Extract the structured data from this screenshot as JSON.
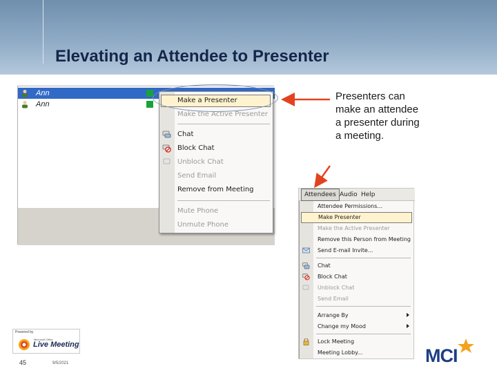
{
  "slide": {
    "title": "Elevating an Attendee to Presenter",
    "page_number": "45",
    "date": "9/5/2021"
  },
  "left_screenshot": {
    "attendees": [
      {
        "name": "Ann",
        "selected": true,
        "status_color": "#17a33a"
      },
      {
        "name": "Ann",
        "selected": false,
        "status_color": "#17a33a"
      }
    ],
    "context_menu": {
      "items": [
        {
          "label": "Make a Presenter",
          "highlighted": true,
          "disabled": false,
          "icon": ""
        },
        {
          "label": "Make the Active Presenter",
          "highlighted": false,
          "disabled": true,
          "icon": ""
        },
        {
          "label": "Chat",
          "highlighted": false,
          "disabled": false,
          "icon": "chat-icon"
        },
        {
          "label": "Block Chat",
          "highlighted": false,
          "disabled": false,
          "icon": "block-chat-icon"
        },
        {
          "label": "Unblock Chat",
          "highlighted": false,
          "disabled": true,
          "icon": "unblock-chat-icon"
        },
        {
          "label": "Send Email",
          "highlighted": false,
          "disabled": true,
          "icon": ""
        },
        {
          "label": "Remove from Meeting",
          "highlighted": false,
          "disabled": false,
          "icon": ""
        },
        {
          "label": "Mute Phone",
          "highlighted": false,
          "disabled": true,
          "icon": ""
        },
        {
          "label": "Unmute Phone",
          "highlighted": false,
          "disabled": true,
          "icon": ""
        }
      ]
    }
  },
  "callout": {
    "text": "Presenters can make an attendee a presenter during a meeting.",
    "arrow_color": "#e2431e"
  },
  "right_screenshot": {
    "menubar": [
      "Attendees",
      "Audio",
      "Help"
    ],
    "open_menu": "Attendees",
    "menu_items": [
      {
        "label": "Attendee Permissions...",
        "highlighted": false,
        "disabled": false,
        "submenu": false
      },
      {
        "label": "Make Presenter",
        "highlighted": true,
        "disabled": false,
        "submenu": false
      },
      {
        "label": "Make the Active Presenter",
        "highlighted": false,
        "disabled": true,
        "submenu": false
      },
      {
        "label": "Remove this Person from Meeting",
        "highlighted": false,
        "disabled": false,
        "submenu": false
      },
      {
        "label": "Send E-mail Invite...",
        "highlighted": false,
        "disabled": false,
        "submenu": false
      },
      {
        "label": "Chat",
        "highlighted": false,
        "disabled": false,
        "submenu": false
      },
      {
        "label": "Block Chat",
        "highlighted": false,
        "disabled": false,
        "submenu": false
      },
      {
        "label": "Unblock Chat",
        "highlighted": false,
        "disabled": true,
        "submenu": false
      },
      {
        "label": "Send Email",
        "highlighted": false,
        "disabled": true,
        "submenu": false
      },
      {
        "label": "Arrange By",
        "highlighted": false,
        "disabled": false,
        "submenu": true
      },
      {
        "label": "Change my Mood",
        "highlighted": false,
        "disabled": false,
        "submenu": true
      },
      {
        "label": "Lock Meeting",
        "highlighted": false,
        "disabled": false,
        "submenu": false
      },
      {
        "label": "Meeting Lobby...",
        "highlighted": false,
        "disabled": false,
        "submenu": false
      }
    ]
  },
  "footer": {
    "live_meeting_logo": {
      "powered_by": "Powered by",
      "small_text": "Microsoft Office",
      "brand": "Live Meeting"
    },
    "mci_logo": {
      "text": "MCI",
      "color": "#1c3e84",
      "star_color": "#f4a21d"
    }
  },
  "colors": {
    "header_blue": "#8fabc6",
    "title_color": "#15264a",
    "selection_blue": "#3169c6",
    "menu_highlight": "#fff3cf"
  }
}
